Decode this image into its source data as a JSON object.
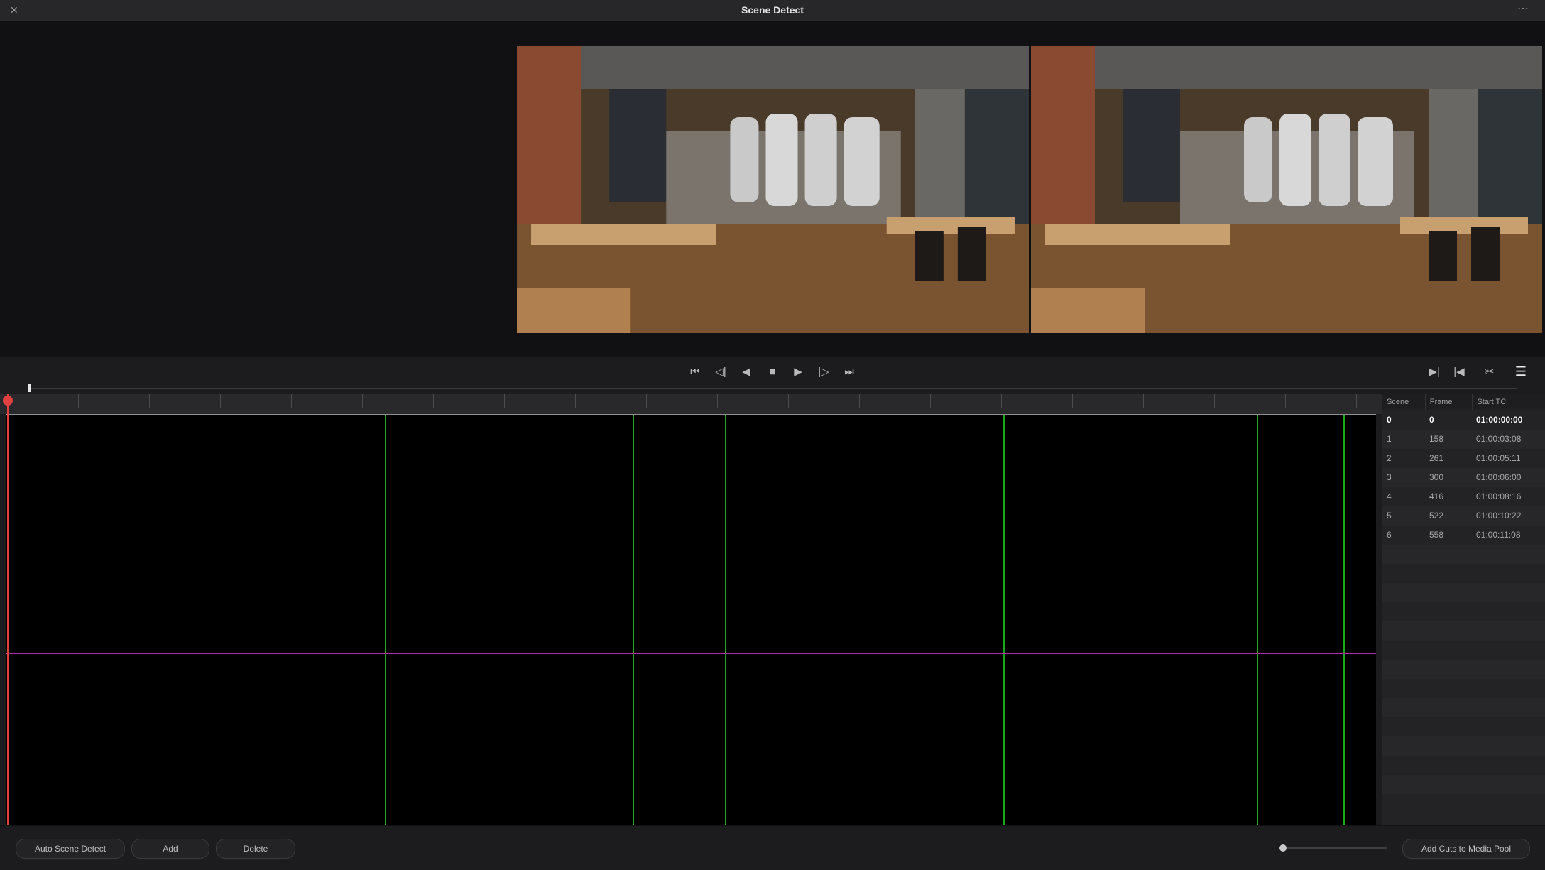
{
  "window": {
    "title": "Scene Detect",
    "close_glyph": "✕",
    "more_glyph": "⋯"
  },
  "transport": {
    "buttons": [
      {
        "name": "jump-to-start-icon",
        "glyph": "⏮"
      },
      {
        "name": "step-back-icon",
        "glyph": "◁|"
      },
      {
        "name": "play-reverse-icon",
        "glyph": "◀"
      },
      {
        "name": "stop-icon",
        "glyph": "■"
      },
      {
        "name": "play-icon",
        "glyph": "▶"
      },
      {
        "name": "step-forward-icon",
        "glyph": "|▷"
      },
      {
        "name": "jump-to-end-icon",
        "glyph": "⏭"
      }
    ],
    "right_tools": [
      {
        "name": "next-cut-icon",
        "glyph": "▶|"
      },
      {
        "name": "previous-cut-icon",
        "glyph": "|◀"
      },
      {
        "name": "scissors-icon",
        "glyph": "✂"
      },
      {
        "name": "list-view-icon",
        "glyph": "☰"
      }
    ]
  },
  "scene_table": {
    "headers": {
      "scene": "Scene",
      "frame": "Frame",
      "start_tc": "Start TC"
    },
    "rows": [
      {
        "scene": "0",
        "frame": "0",
        "start_tc": "01:00:00:00"
      },
      {
        "scene": "1",
        "frame": "158",
        "start_tc": "01:00:03:08"
      },
      {
        "scene": "2",
        "frame": "261",
        "start_tc": "01:00:05:11"
      },
      {
        "scene": "3",
        "frame": "300",
        "start_tc": "01:00:06:00"
      },
      {
        "scene": "4",
        "frame": "416",
        "start_tc": "01:00:08:16"
      },
      {
        "scene": "5",
        "frame": "522",
        "start_tc": "01:00:10:22"
      },
      {
        "scene": "6",
        "frame": "558",
        "start_tc": "01:00:11:08"
      }
    ],
    "selected_index": 0
  },
  "footer": {
    "auto_scene_detect": "Auto Scene Detect",
    "add": "Add",
    "delete": "Delete",
    "add_cuts": "Add Cuts to Media Pool"
  },
  "colors": {
    "cut_line": "#18a818",
    "threshold_line": "#b028b0",
    "playhead": "#e04040"
  }
}
